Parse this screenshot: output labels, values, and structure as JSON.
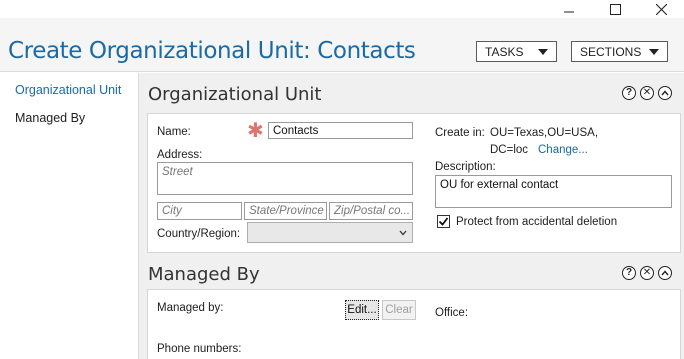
{
  "window": {
    "title": "Create Organizational Unit: Contacts",
    "tasks_label": "TASKS",
    "sections_label": "SECTIONS"
  },
  "nav": {
    "items": [
      {
        "label": "Organizational Unit",
        "active": true
      },
      {
        "label": "Managed By",
        "active": false
      }
    ]
  },
  "ou_section": {
    "heading": "Organizational Unit",
    "name_label": "Name:",
    "name_value": "Contacts",
    "address_label": "Address:",
    "street_placeholder": "Street",
    "city_placeholder": "City",
    "state_placeholder": "State/Province",
    "zip_placeholder": "Zip/Postal co...",
    "country_label": "Country/Region:",
    "country_value": "",
    "create_in_label": "Create in:",
    "create_in_line1": "OU=Texas,OU=USA,",
    "create_in_line2": "DC=loc",
    "change_link": "Change...",
    "description_label": "Description:",
    "description_value": "OU for external contact",
    "protect_label": "Protect from accidental deletion",
    "protect_checked": true
  },
  "mb_section": {
    "heading": "Managed By",
    "managed_by_label": "Managed by:",
    "edit_label": "Edit...",
    "clear_label": "Clear",
    "office_label": "Office:",
    "phone_label": "Phone numbers:"
  },
  "colors": {
    "accent": "#1b6aa5",
    "required": "#e0736e",
    "content_bg": "#f0f0f0"
  }
}
